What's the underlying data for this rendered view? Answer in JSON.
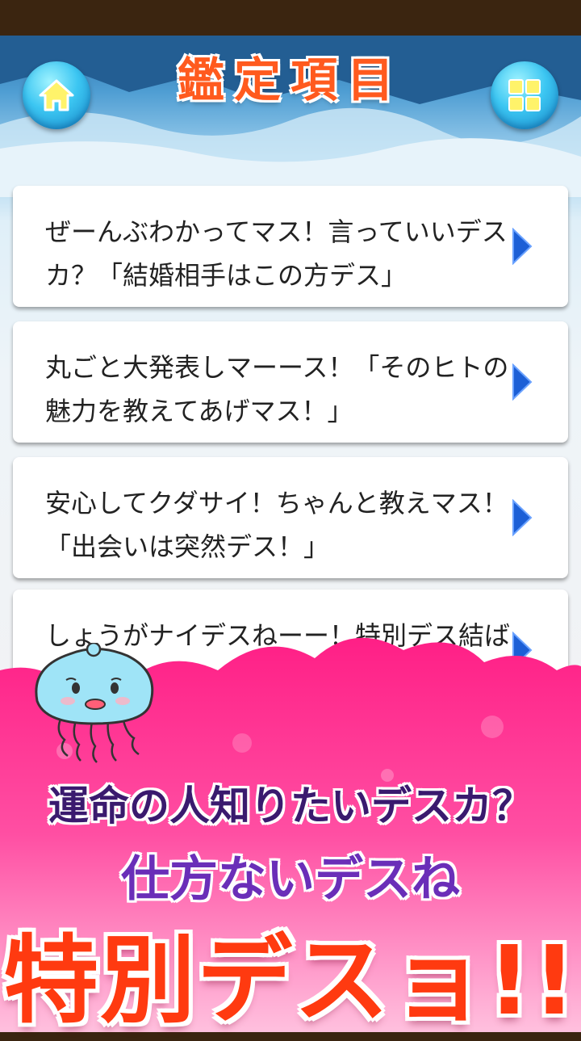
{
  "header": {
    "title": "鑑定項目",
    "home_button": "home-icon",
    "menu_button": "grid-menu-icon"
  },
  "items": [
    {
      "text": "ぜーんぶわかってマス！言っていいデスカ？「結婚相手はこの方デス」"
    },
    {
      "text": "丸ごと大発表しマーース！「そのヒトの魅力を教えてあげマス！」"
    },
    {
      "text": "安心してクダサイ！ちゃんと教えマス！「出会いは突然デス！」"
    },
    {
      "text": "しょうがナイデスねーー！特別デス結ばれる秘密マス！」"
    }
  ],
  "banner": {
    "line1": "運命の人知りたいデスカ？",
    "line2": "仕方ないデスね",
    "line3": "特別デスョ!!"
  },
  "colors": {
    "title": "#ff5a1e",
    "banner_pink": "#ff2a8a",
    "line1": "#3a1a6e",
    "line2": "#6a2eb8",
    "line3": "#ff3a10",
    "arrow": "#1c5fd6"
  }
}
